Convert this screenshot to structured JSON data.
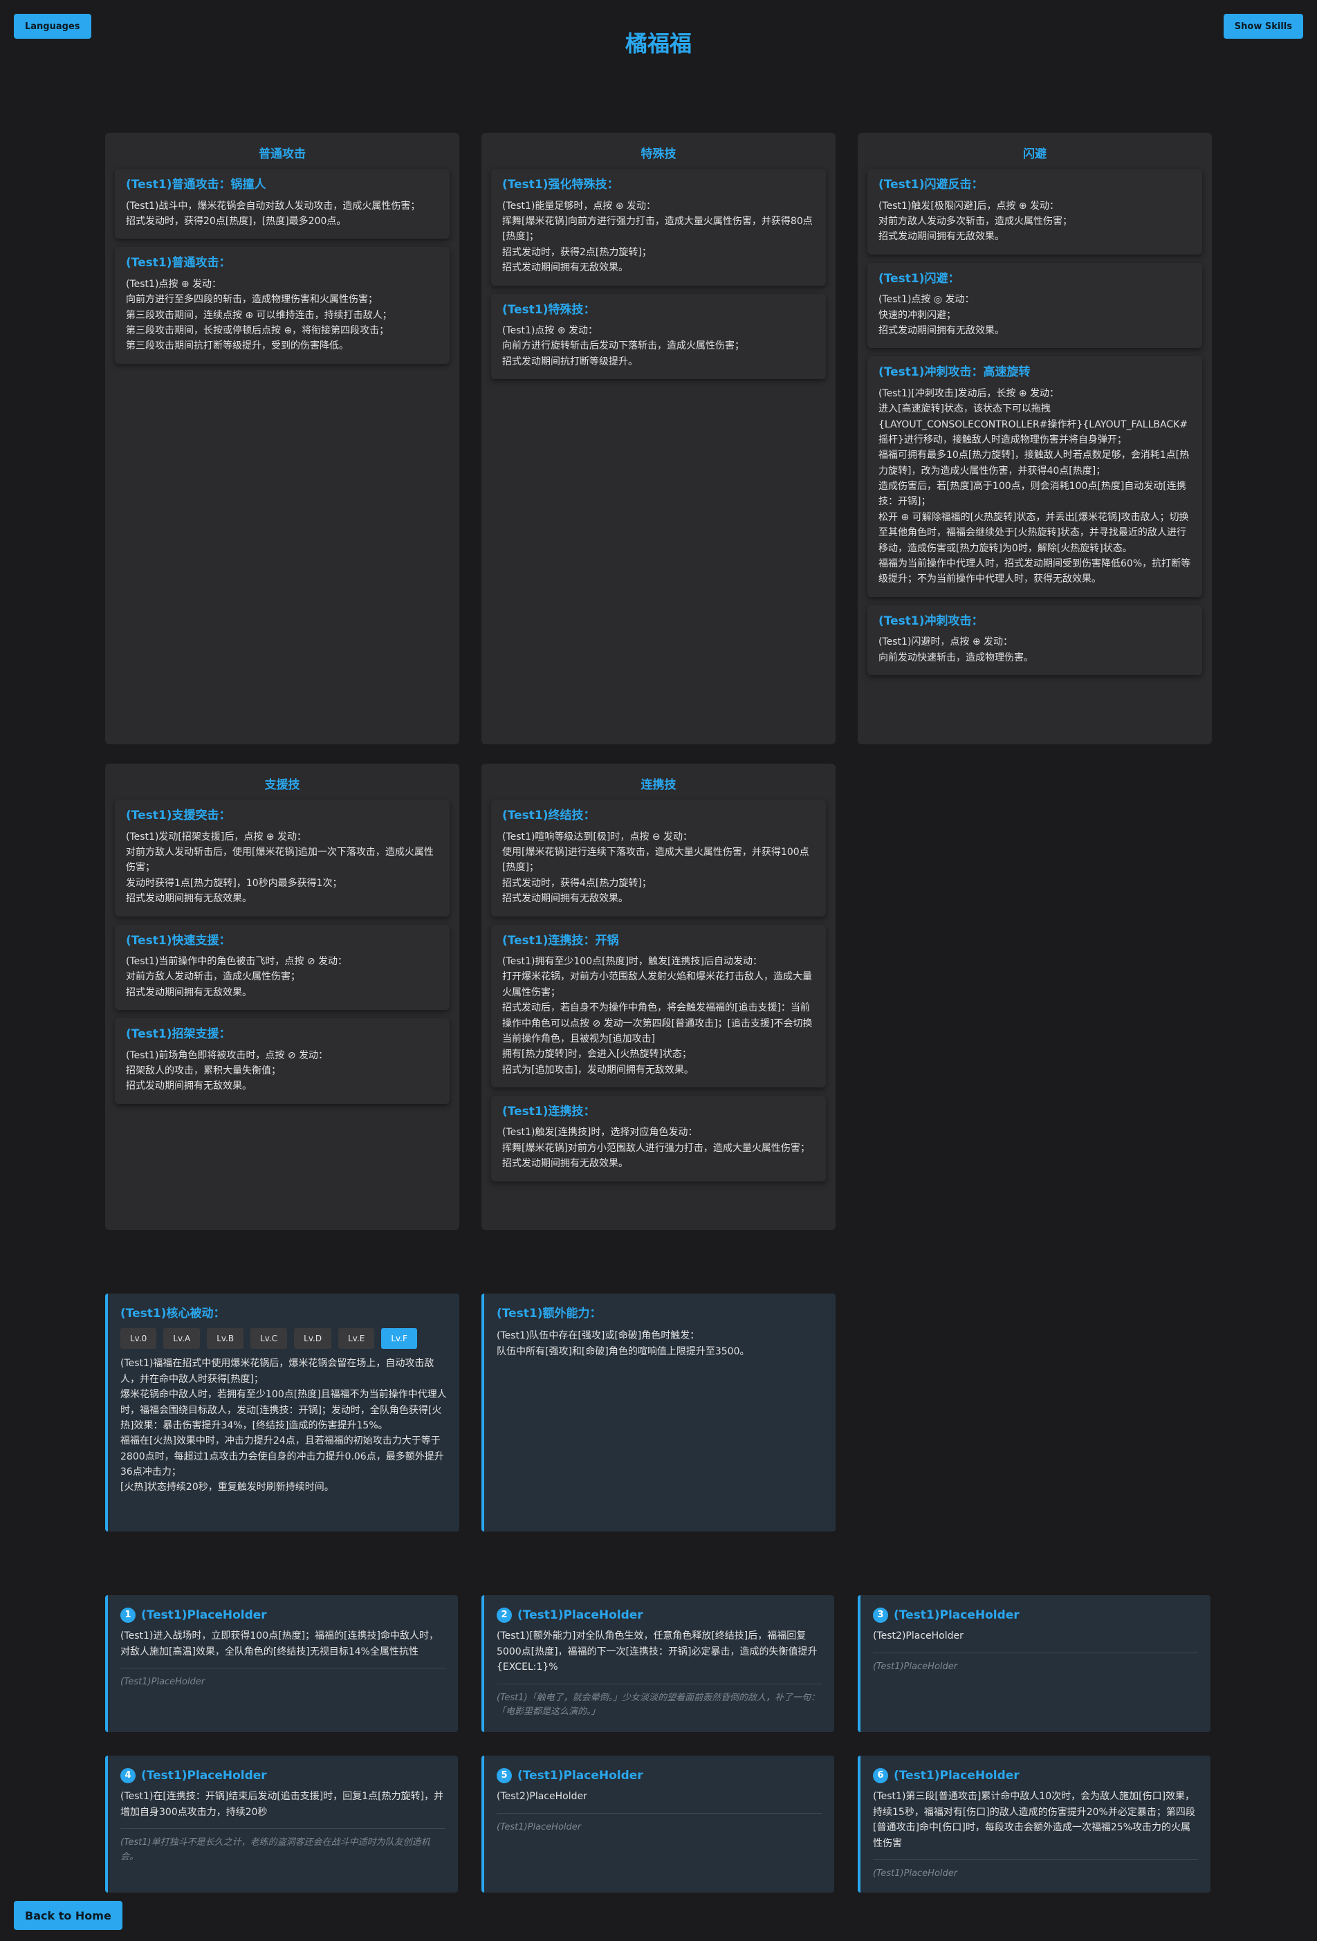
{
  "header": {
    "languages_label": "Languages",
    "show_skills_label": "Show Skills",
    "title": "橘福福"
  },
  "panels": [
    {
      "title": "普通攻击",
      "cards": [
        {
          "title": "(Test1)普通攻击：锅撞人",
          "body": "(Test1)战斗中，爆米花锅会自动对敌人发动攻击，造成火属性伤害；\n招式发动时，获得20点[热度]，[热度]最多200点。"
        },
        {
          "title": "(Test1)普通攻击：",
          "body": "(Test1)点按 ⊕ 发动：\n向前方进行至多四段的斩击，造成物理伤害和火属性伤害；\n第三段攻击期间，连续点按 ⊕ 可以维持连击，持续打击敌人；\n第三段攻击期间，长按或停顿后点按 ⊕，将衔接第四段攻击；\n第三段攻击期间抗打断等级提升，受到的伤害降低。"
        }
      ]
    },
    {
      "title": "特殊技",
      "cards": [
        {
          "title": "(Test1)强化特殊技：",
          "body": "(Test1)能量足够时，点按 ⊛ 发动：\n挥舞[爆米花锅]向前方进行强力打击，造成大量火属性伤害，并获得80点[热度]；\n招式发动时，获得2点[热力旋转]；\n招式发动期间拥有无敌效果。"
        },
        {
          "title": "(Test1)特殊技：",
          "body": "(Test1)点按 ⊛ 发动：\n向前方进行旋转斩击后发动下落斩击，造成火属性伤害；\n招式发动期间抗打断等级提升。"
        }
      ]
    },
    {
      "title": "闪避",
      "cards": [
        {
          "title": "(Test1)闪避反击：",
          "body": "(Test1)触发[极限闪避]后，点按 ⊕ 发动：\n对前方敌人发动多次斩击，造成火属性伤害；\n招式发动期间拥有无敌效果。"
        },
        {
          "title": "(Test1)闪避：",
          "body": "(Test1)点按 ◎ 发动：\n快速的冲刺闪避；\n招式发动期间拥有无敌效果。"
        },
        {
          "title": "(Test1)冲刺攻击：高速旋转",
          "body": "(Test1)[冲刺攻击]发动后，长按 ⊕ 发动：\n进入[高速旋转]状态，该状态下可以拖拽{LAYOUT_CONSOLECONTROLLER#操作杆}{LAYOUT_FALLBACK#摇杆}进行移动，接触敌人时造成物理伤害并将自身弹开；\n福福可拥有最多10点[热力旋转]，接触敌人时若点数足够，会消耗1点[热力旋转]，改为造成火属性伤害，并获得40点[热度]；\n造成伤害后，若[热度]高于100点，则会消耗100点[热度]自动发动[连携技：开锅]；\n松开 ⊕ 可解除福福的[火热旋转]状态，并丢出[爆米花锅]攻击敌人；切换至其他角色时，福福会继续处于[火热旋转]状态，并寻找最近的敌人进行移动，造成伤害或[热力旋转]为0时，解除[火热旋转]状态。\n福福为当前操作中代理人时，招式发动期间受到伤害降低60%，抗打断等级提升；不为当前操作中代理人时，获得无敌效果。"
        },
        {
          "title": "(Test1)冲刺攻击：",
          "body": "(Test1)闪避时，点按 ⊕ 发动：\n向前发动快速斩击，造成物理伤害。"
        }
      ]
    },
    {
      "title": "支援技",
      "cards": [
        {
          "title": "(Test1)支援突击：",
          "body": "(Test1)发动[招架支援]后，点按 ⊕ 发动：\n对前方敌人发动斩击后，使用[爆米花锅]追加一次下落攻击，造成火属性伤害；\n发动时获得1点[热力旋转]，10秒内最多获得1次；\n招式发动期间拥有无敌效果。"
        },
        {
          "title": "(Test1)快速支援：",
          "body": "(Test1)当前操作中的角色被击飞时，点按 ⊘ 发动：\n对前方敌人发动斩击，造成火属性伤害；\n招式发动期间拥有无敌效果。"
        },
        {
          "title": "(Test1)招架支援：",
          "body": "(Test1)前场角色即将被攻击时，点按 ⊘ 发动：\n招架敌人的攻击，累积大量失衡值；\n招式发动期间拥有无敌效果。"
        }
      ]
    },
    {
      "title": "连携技",
      "cards": [
        {
          "title": "(Test1)终结技：",
          "body": "(Test1)喧响等级达到[极]时，点按 ⊖ 发动：\n使用[爆米花锅]进行连续下落攻击，造成大量火属性伤害，并获得100点[热度]；\n招式发动时，获得4点[热力旋转]；\n招式发动期间拥有无敌效果。"
        },
        {
          "title": "(Test1)连携技：开锅",
          "body": "(Test1)拥有至少100点[热度]时，触发[连携技]后自动发动：\n打开爆米花锅，对前方小范围敌人发射火焰和爆米花打击敌人，造成大量火属性伤害；\n招式发动后，若自身不为操作中角色，将会触发福福的[追击支援]：当前操作中角色可以点按 ⊘ 发动一次第四段[普通攻击]；[追击支援]不会切换当前操作角色，且被视为[追加攻击]\n拥有[热力旋转]时，会进入[火热旋转]状态；\n招式为[追加攻击]，发动期间拥有无敌效果。"
        },
        {
          "title": "(Test1)连携技：",
          "body": "(Test1)触发[连携技]时，选择对应角色发动：\n挥舞[爆米花锅]对前方小范围敌人进行强力打击，造成大量火属性伤害；\n招式发动期间拥有无敌效果。"
        }
      ]
    }
  ],
  "core_passive": {
    "title": "(Test1)核心被动：",
    "levels": [
      "Lv.0",
      "Lv.A",
      "Lv.B",
      "Lv.C",
      "Lv.D",
      "Lv.E",
      "Lv.F"
    ],
    "active_level": "Lv.F",
    "body": "(Test1)福福在招式中使用爆米花锅后，爆米花锅会留在场上，自动攻击敌人，并在命中敌人时获得[热度]；\n爆米花锅命中敌人时，若拥有至少100点[热度]且福福不为当前操作中代理人时，福福会围绕目标敌人，发动[连携技：开锅]；发动时，全队角色获得[火热]效果：暴击伤害提升34%，[终结技]造成的伤害提升15%。\n福福在[火热]效果中时，冲击力提升24点，且若福福的初始攻击力大于等于2800点时，每超过1点攻击力会使自身的冲击力提升0.06点，最多额外提升36点冲击力；\n[火热]状态持续20秒，重复触发时刷新持续时间。"
  },
  "extra_ability": {
    "title": "(Test1)额外能力：",
    "body": "(Test1)队伍中存在[强攻]或[命破]角色时触发：\n队伍中所有[强攻]和[命破]角色的喧响值上限提升至3500。"
  },
  "placeholders": [
    {
      "num": "1",
      "title": "(Test1)PlaceHolder",
      "body": "(Test1)进入战场时，立即获得100点[热度]；福福的[连携技]命中敌人时，对敌人施加[高温]效果，全队角色的[终结技]无视目标14%全属性抗性",
      "quote": "(Test1)PlaceHolder"
    },
    {
      "num": "2",
      "title": "(Test1)PlaceHolder",
      "body": "(Test1)[额外能力]对全队角色生效，任意角色释放[终结技]后，福福回复5000点[热度]，福福的下一次[连携技：开锅]必定暴击，造成的失衡值提升{EXCEL:1}%",
      "quote": "(Test1)「触电了，就会晕倒。」少女淡淡的望着面前轰然昏倒的敌人，补了一句：「电影里都是这么演的。」"
    },
    {
      "num": "3",
      "title": "(Test1)PlaceHolder",
      "body": "(Test2)PlaceHolder",
      "quote": "(Test1)PlaceHolder"
    },
    {
      "num": "4",
      "title": "(Test1)PlaceHolder",
      "body": "(Test1)在[连携技：开锅]结束后发动[追击支援]时，回复1点[热力旋转]，并增加自身300点攻击力，持续20秒",
      "quote": "(Test1)单打独斗不是长久之计，老练的盗洞客还会在战斗中适时为队友创造机会。"
    },
    {
      "num": "5",
      "title": "(Test1)PlaceHolder",
      "body": "(Test2)PlaceHolder",
      "quote": "(Test1)PlaceHolder"
    },
    {
      "num": "6",
      "title": "(Test1)PlaceHolder",
      "body": "(Test1)第三段[普通攻击]累计命中敌人10次时，会为敌人施加[伤口]效果，持续15秒，福福对有[伤口]的敌人造成的伤害提升20%并必定暴击；第四段[普通攻击]命中[伤口]时，每段攻击会额外造成一次福福25%攻击力的火属性伤害",
      "quote": "(Test1)PlaceHolder"
    }
  ],
  "footer": {
    "back_label": "Back to Home"
  },
  "colors": {
    "accent": "#2aa7ee",
    "fire": "#ff5533",
    "physical": "#f0c000",
    "green": "#58c83a",
    "bg": "#1b1b1d",
    "panel": "#2b2b2d"
  }
}
